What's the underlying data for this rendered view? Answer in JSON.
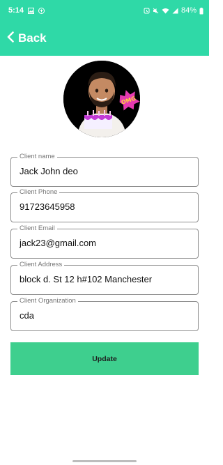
{
  "status_bar": {
    "time": "5:14",
    "battery": "84%",
    "left_icons": [
      "image-icon",
      "notification-icon"
    ],
    "right_icons": [
      "alarm-icon",
      "mute-icon",
      "wifi-icon",
      "signal-icon",
      "battery-icon"
    ]
  },
  "app_bar": {
    "back_label": "Back",
    "color": "#2fd9a7"
  },
  "profile": {
    "avatar_icon": "memoji-avatar",
    "sticker_text": "OMG"
  },
  "form": {
    "fields": [
      {
        "label": "Client name",
        "value": "Jack John deo"
      },
      {
        "label": "Client Phone",
        "value": "91723645958"
      },
      {
        "label": "Client Email",
        "value": "jack23@gmail.com"
      },
      {
        "label": "Client Address",
        "value": "block d. St 12 h#102 Manchester"
      },
      {
        "label": "Client Organization",
        "value": "cda"
      }
    ],
    "update_label": "Update",
    "button_color": "#3ecf8e"
  }
}
